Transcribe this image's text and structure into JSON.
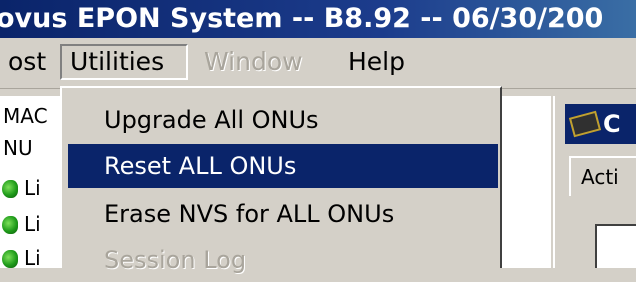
{
  "window": {
    "title": "ovus EPON System -- B8.92 -- 06/30/200"
  },
  "menubar": {
    "items": [
      {
        "label": "ost",
        "state": "normal"
      },
      {
        "label": "Utilities",
        "state": "open"
      },
      {
        "label": "Window",
        "state": "disabled"
      },
      {
        "label": "Help",
        "state": "normal"
      }
    ]
  },
  "utilities_menu": {
    "items": [
      {
        "label": "Upgrade All ONUs",
        "state": "normal"
      },
      {
        "label": "Reset ALL ONUs",
        "state": "highlighted"
      },
      {
        "label": "Erase NVS for ALL ONUs",
        "state": "normal"
      },
      {
        "label": "Session Log",
        "state": "disabled"
      }
    ]
  },
  "left_pane": {
    "header_1": "MAC",
    "header_2": "NU",
    "rows": [
      {
        "label": "Li"
      },
      {
        "label": "Li"
      },
      {
        "label": "Li"
      }
    ]
  },
  "right_pane": {
    "header_text": "C",
    "tab_label": "Acti"
  },
  "colors": {
    "highlight": "#0a246a",
    "face": "#d4d0c8",
    "disabled_text": "#a9a59c"
  }
}
